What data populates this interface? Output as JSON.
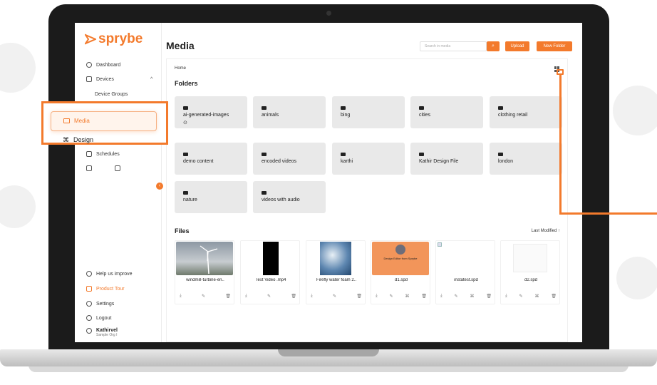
{
  "app": {
    "logo_text": "sprybe",
    "page_title": "Media"
  },
  "sidebar": {
    "items": [
      {
        "label": "Dashboard",
        "icon": "clock-icon"
      },
      {
        "label": "Devices",
        "icon": "devices-icon"
      },
      {
        "label": "Device Groups",
        "icon": ""
      },
      {
        "label": "Media",
        "icon": "image-icon"
      },
      {
        "label": "Design",
        "icon": "design-icon"
      },
      {
        "label": "Schedules",
        "icon": "calendar-icon"
      }
    ],
    "bottom": [
      {
        "label": "Help us improve",
        "icon": "help-icon"
      },
      {
        "label": "Product Tour",
        "icon": "tour-icon"
      },
      {
        "label": "Settings",
        "icon": "gear-icon"
      },
      {
        "label": "Logout",
        "icon": "logout-icon"
      }
    ],
    "user": {
      "name": "Kathirvel",
      "org": "Sample Org I"
    }
  },
  "header": {
    "search_placeholder": "Search in media",
    "upload_label": "Upload",
    "new_folder_label": "New Folder"
  },
  "breadcrumb": "Home",
  "folders_title": "Folders",
  "folders": [
    {
      "name": "ai-generated-images",
      "sub": "⊙"
    },
    {
      "name": "animals"
    },
    {
      "name": "bing"
    },
    {
      "name": "cities"
    },
    {
      "name": "clothing retail"
    },
    {
      "name": "demo content"
    },
    {
      "name": "encoded videos"
    },
    {
      "name": "karthi"
    },
    {
      "name": "Kathir Design File"
    },
    {
      "name": "london"
    },
    {
      "name": "nature"
    },
    {
      "name": "videos with audio"
    }
  ],
  "files_title": "Files",
  "sort_label": "Last Modified ↑",
  "files": [
    {
      "name": "windmill-turbine-en..",
      "thumb": "windmill"
    },
    {
      "name": "Test Video .mp4",
      "thumb": "video"
    },
    {
      "name": "Firefly water foam 2..",
      "thumb": "water"
    },
    {
      "name": "d1.spd",
      "thumb": "design",
      "thumb_text": "Design Editor from Sprybe"
    },
    {
      "name": "instatest.spd",
      "thumb": "broken"
    },
    {
      "name": "d2.spd",
      "thumb": "blank"
    }
  ],
  "colors": {
    "accent": "#f37a2c"
  }
}
